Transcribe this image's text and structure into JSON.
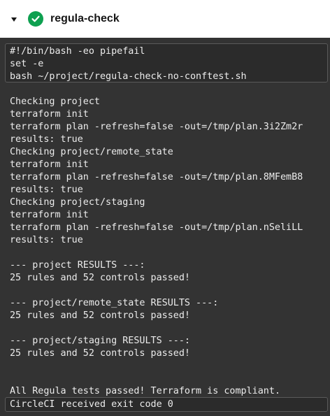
{
  "step": {
    "title": "regula-check",
    "status": "success"
  },
  "command_lines": [
    "#!/bin/bash -eo pipefail",
    "set -e",
    "bash ~/project/regula-check-no-conftest.sh"
  ],
  "output_lines": [
    "Checking project",
    "terraform init",
    "terraform plan -refresh=false -out=/tmp/plan.3i2Zm2r",
    "results: true",
    "Checking project/remote_state",
    "terraform init",
    "terraform plan -refresh=false -out=/tmp/plan.8MFemB8",
    "results: true",
    "Checking project/staging",
    "terraform init",
    "terraform plan -refresh=false -out=/tmp/plan.nSeliLL",
    "results: true",
    "",
    "--- project RESULTS ---:",
    "25 rules and 52 controls passed!",
    "",
    "--- project/remote_state RESULTS ---:",
    "25 rules and 52 controls passed!",
    "",
    "--- project/staging RESULTS ---:",
    "25 rules and 52 controls passed!",
    "",
    "",
    "All Regula tests passed! Terraform is compliant."
  ],
  "exit_message": "CircleCI received exit code 0",
  "colors": {
    "success": "#0ea050",
    "terminal_bg": "#333333",
    "terminal_text": "#ececec"
  },
  "icons": {
    "toggle": "chevron-down-icon",
    "status": "check-circle-icon"
  }
}
